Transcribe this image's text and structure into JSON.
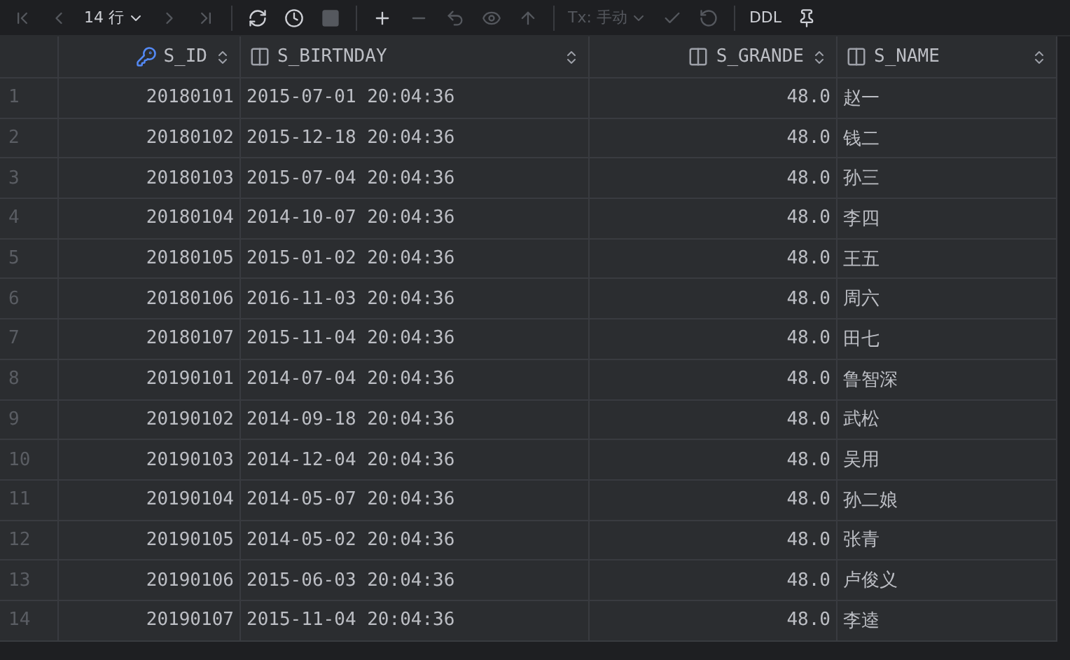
{
  "toolbar": {
    "row_count": "14 行",
    "tx_mode": "Tx: 手动",
    "ddl": "DDL",
    "buttons": [
      {
        "disabled": true
      },
      {
        "disabled": true
      },
      {
        "disabled": false
      },
      {
        "disabled": true
      },
      {
        "disabled": true
      },
      {
        "disabled": false
      },
      {
        "disabled": false
      },
      {
        "disabled": true
      },
      {
        "disabled": false
      },
      {
        "disabled": true
      },
      {
        "disabled": true
      },
      {
        "disabled": true
      },
      {
        "disabled": true
      },
      {
        "disabled": true
      },
      {
        "disabled": true
      },
      {
        "disabled": true
      },
      {
        "disabled": false
      },
      {
        "disabled": false
      }
    ]
  },
  "table": {
    "columns": [
      {
        "label": "S_ID",
        "kind": "key"
      },
      {
        "label": "S_BIRTNDAY",
        "kind": "column"
      },
      {
        "label": "S_GRANDE",
        "kind": "column"
      },
      {
        "label": "S_NAME",
        "kind": "column"
      }
    ],
    "rows": [
      {
        "number": "1",
        "cells": [
          "20180101",
          "2015-07-01 20:04:36",
          "48.0",
          "赵一"
        ]
      },
      {
        "number": "2",
        "cells": [
          "20180102",
          "2015-12-18 20:04:36",
          "48.0",
          "钱二"
        ]
      },
      {
        "number": "3",
        "cells": [
          "20180103",
          "2015-07-04 20:04:36",
          "48.0",
          "孙三"
        ]
      },
      {
        "number": "4",
        "cells": [
          "20180104",
          "2014-10-07 20:04:36",
          "48.0",
          "李四"
        ]
      },
      {
        "number": "5",
        "cells": [
          "20180105",
          "2015-01-02 20:04:36",
          "48.0",
          "王五"
        ]
      },
      {
        "number": "6",
        "cells": [
          "20180106",
          "2016-11-03 20:04:36",
          "48.0",
          "周六"
        ]
      },
      {
        "number": "7",
        "cells": [
          "20180107",
          "2015-11-04 20:04:36",
          "48.0",
          "田七"
        ]
      },
      {
        "number": "8",
        "cells": [
          "20190101",
          "2014-07-04 20:04:36",
          "48.0",
          "鲁智深"
        ]
      },
      {
        "number": "9",
        "cells": [
          "20190102",
          "2014-09-18 20:04:36",
          "48.0",
          "武松"
        ]
      },
      {
        "number": "10",
        "cells": [
          "20190103",
          "2014-12-04 20:04:36",
          "48.0",
          "吴用"
        ]
      },
      {
        "number": "11",
        "cells": [
          "20190104",
          "2014-05-07 20:04:36",
          "48.0",
          "孙二娘"
        ]
      },
      {
        "number": "12",
        "cells": [
          "20190105",
          "2014-05-02 20:04:36",
          "48.0",
          "张青"
        ]
      },
      {
        "number": "13",
        "cells": [
          "20190106",
          "2015-06-03 20:04:36",
          "48.0",
          "卢俊义"
        ]
      },
      {
        "number": "14",
        "cells": [
          "20190107",
          "2015-11-04 20:04:36",
          "48.0",
          "李逵"
        ]
      }
    ]
  }
}
